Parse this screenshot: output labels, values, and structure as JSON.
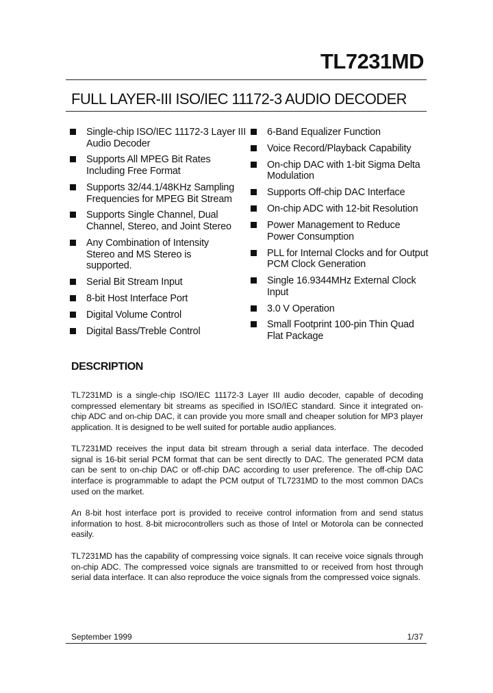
{
  "header": {
    "part_number": "TL7231MD",
    "subtitle": "FULL LAYER-III ISO/IEC 11172-3 AUDIO DECODER"
  },
  "features": {
    "left": [
      "Single-chip ISO/IEC 11172-3 Layer III Audio Decoder",
      "Supports All MPEG Bit Rates Including Free Format",
      "Supports 32/44.1/48KHz Sampling Frequencies for MPEG Bit Stream",
      "Supports Single Channel, Dual Channel, Stereo, and Joint Stereo",
      "Any Combination of Intensity Stereo and MS Stereo is supported.",
      "Serial Bit Stream Input",
      "8-bit Host Interface Port",
      "Digital Volume Control",
      "Digital Bass/Treble Control"
    ],
    "right": [
      "6-Band Equalizer Function",
      "Voice Record/Playback Capability",
      "On-chip DAC with 1-bit Sigma Delta Modulation",
      "Supports Off-chip DAC Interface",
      "On-chip ADC with 12-bit Resolution",
      "Power Management to Reduce Power Consumption",
      "PLL for Internal Clocks and for Output PCM Clock Generation",
      "Single 16.9344MHz External Clock Input",
      "3.0 V Operation",
      "Small Footprint 100-pin Thin Quad Flat Package"
    ]
  },
  "description": {
    "heading": "DESCRIPTION",
    "paragraphs": [
      "TL7231MD is a single-chip ISO/IEC 11172-3 Layer III audio decoder, capable of decoding compressed elementary bit streams as specified in ISO/IEC standard. Since it integrated on-chip ADC and on-chip DAC, it can provide you more small and cheaper solution for MP3 player application. It is designed to be well suited for portable audio appliances.",
      "TL7231MD receives the input data bit stream through a serial data interface. The decoded signal is 16-bit serial PCM format that can be sent directly to DAC. The generated PCM data can be sent to on-chip DAC or off-chip DAC according to user preference. The off-chip DAC interface is programmable to adapt the PCM output of TL7231MD to the most common DACs used on the market.",
      "An 8-bit host interface port is provided to receive control information from and send status information to host. 8-bit microcontrollers such as those of Intel or Motorola can be connected easily.",
      "TL7231MD has the capability of compressing voice signals. It can receive voice signals through on-chip ADC. The compressed voice signals are transmitted to or received from host through serial data interface. It can also reproduce the voice signals from the compressed voice signals."
    ]
  },
  "footer": {
    "date": "September 1999",
    "page": "1/37"
  }
}
